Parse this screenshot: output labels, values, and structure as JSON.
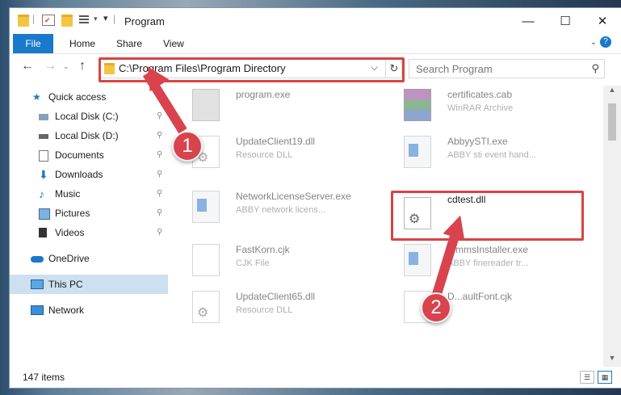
{
  "window": {
    "title": "Program",
    "controls": {
      "minimize": "—",
      "maximize": "☐",
      "close": "✕"
    }
  },
  "ribbon": {
    "tabs": [
      "File",
      "Home",
      "Share",
      "View"
    ],
    "expand_icon": "chevron-down-icon",
    "help": "?"
  },
  "address": {
    "path": "C:\\Program Files\\Program Directory",
    "dropdown": "⌵",
    "refresh": "↻",
    "search_placeholder": "Search Program",
    "search_glyph": "⚲"
  },
  "sidebar": {
    "items": [
      {
        "label": "Quick access",
        "icon": "star-icon",
        "pinned": false
      },
      {
        "label": "Local Disk (C:)",
        "icon": "drive-icon",
        "pinned": true
      },
      {
        "label": "Local Disk (D:)",
        "icon": "drive-icon",
        "pinned": true
      },
      {
        "label": "Documents",
        "icon": "documents-icon",
        "pinned": true
      },
      {
        "label": "Downloads",
        "icon": "downloads-icon",
        "pinned": true
      },
      {
        "label": "Music",
        "icon": "music-icon",
        "pinned": true
      },
      {
        "label": "Pictures",
        "icon": "pictures-icon",
        "pinned": true
      },
      {
        "label": "Videos",
        "icon": "videos-icon",
        "pinned": true
      },
      {
        "label": "OneDrive",
        "icon": "cloud-icon",
        "pinned": false
      },
      {
        "label": "This PC",
        "icon": "computer-icon",
        "pinned": false,
        "selected": true
      },
      {
        "label": "Network",
        "icon": "network-icon",
        "pinned": false
      }
    ],
    "pin_glyph": "📌"
  },
  "files": [
    {
      "name": "program.exe",
      "type": "",
      "icon": "program-icon"
    },
    {
      "name": "certificates.cab",
      "type": "WinRAR Archive",
      "icon": "archive-icon"
    },
    {
      "name": "UpdateClient19.dll",
      "type": "Resource DLL",
      "icon": "dll-icon"
    },
    {
      "name": "AbbyySTI.exe",
      "type": "ABBY sti event hand...",
      "icon": "app-icon"
    },
    {
      "name": "NetworkLicenseServer.exe",
      "type": "ABBY network licens...",
      "icon": "app-icon"
    },
    {
      "name": "cdtest.dll",
      "type": "",
      "icon": "dll-icon"
    },
    {
      "name": "FastKorn.cjk",
      "type": "CJK File",
      "icon": "file-icon"
    },
    {
      "name": "...mmsInstaller.exe",
      "type": "ABBY finereader tr...",
      "icon": "app-icon"
    },
    {
      "name": "UpdateClient65.dll",
      "type": "Resource DLL",
      "icon": "dll-icon"
    },
    {
      "name": "D...aultFont.cjk",
      "type": "",
      "icon": "file-icon"
    }
  ],
  "status": {
    "count": "147 items"
  },
  "callouts": [
    "1",
    "2"
  ],
  "colors": {
    "accent": "#1979ca",
    "highlight": "#d84444",
    "selected": "#cce0f0"
  }
}
